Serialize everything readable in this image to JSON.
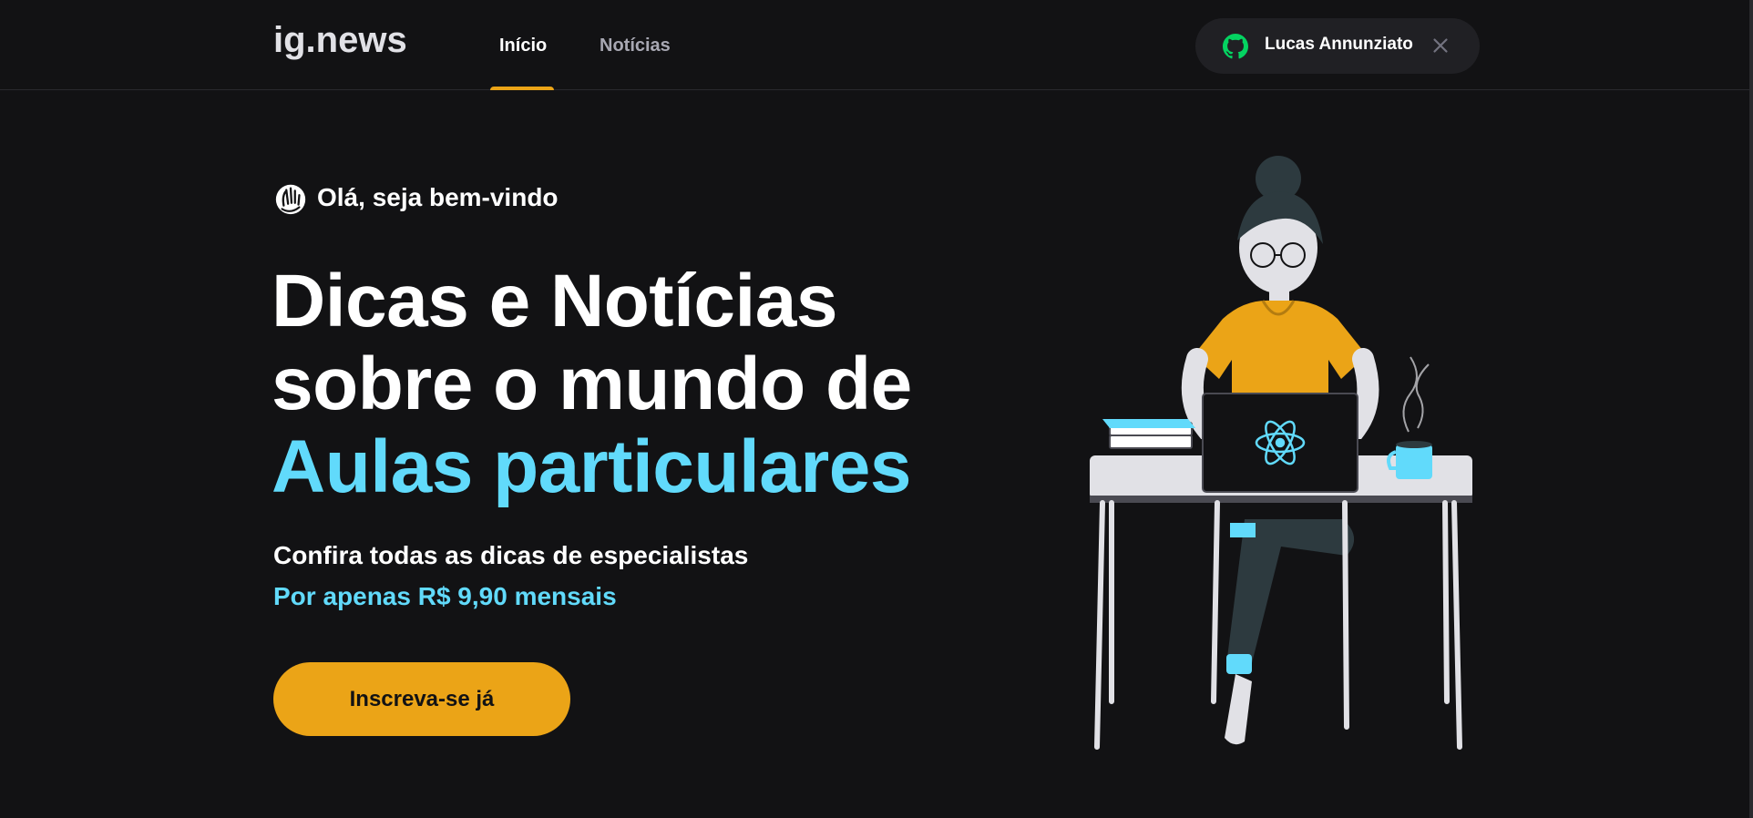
{
  "header": {
    "logo": "ig.news",
    "nav": [
      {
        "label": "Início",
        "active": true
      },
      {
        "label": "Notícias",
        "active": false
      }
    ],
    "user": {
      "name": "Lucas Annunziato",
      "icon": "github-icon",
      "close_icon": "close-icon"
    }
  },
  "hero": {
    "greeting": "Olá, seja bem-vindo",
    "greeting_icon": "waving-hand-icon",
    "headline_line1": "Dicas e Notícias",
    "headline_line2": "sobre o mundo de",
    "headline_accent": "Aulas particulares",
    "subtitle": "Confira todas as dicas de especialistas",
    "price": "Por apenas R$ 9,90 mensais",
    "cta": "Inscreva-se já"
  },
  "colors": {
    "background": "#121214",
    "accent_yellow": "#eba417",
    "accent_cyan": "#61dafb",
    "github_green": "#04d361"
  }
}
